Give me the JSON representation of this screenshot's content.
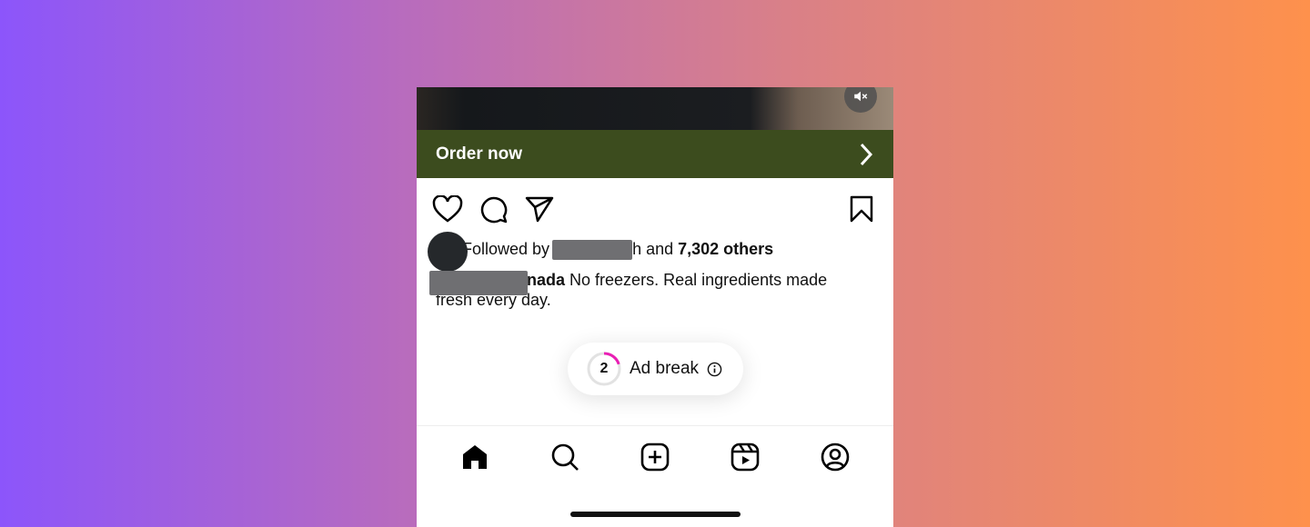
{
  "post": {
    "cta_label": "Order now",
    "followed_prefix": "Followed by",
    "followed_middle": "h and",
    "followed_count": "7,302 others",
    "caption_username_tail": "nada",
    "caption_text": "No freezers. Real ingredients made fresh every day."
  },
  "ad_break": {
    "count": "2",
    "label": "Ad break",
    "progress": 0.2,
    "accent": "#e91fb4"
  },
  "nav": {
    "items": [
      "home-icon",
      "search-icon",
      "create-icon",
      "reels-icon",
      "profile-icon"
    ]
  },
  "colors": {
    "cta_bg": "#3c4c1e"
  }
}
